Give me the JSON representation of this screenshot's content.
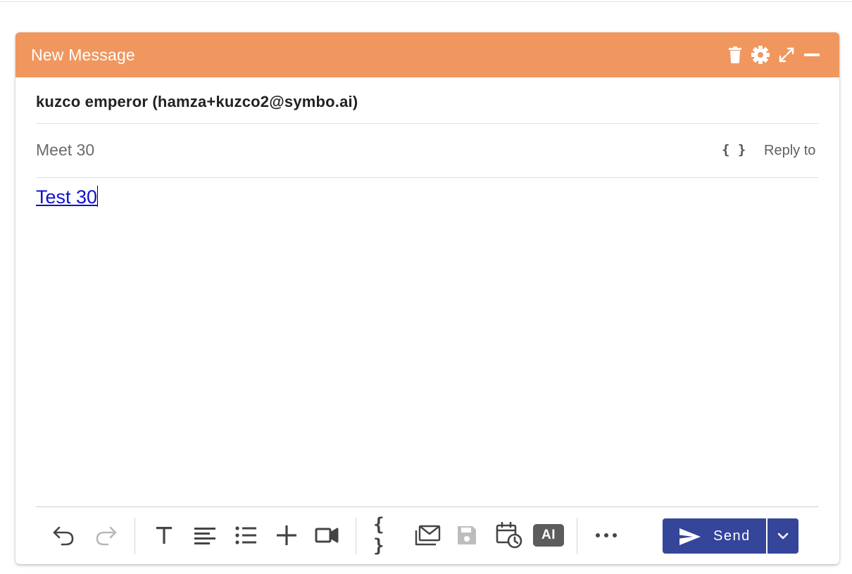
{
  "compose": {
    "title": "New Message",
    "header_color": "#f0975f",
    "recipient": "kuzco emperor (hamza+kuzco2@symbo.ai)",
    "subject": "Meet 30",
    "subject_variable_icon": "{ }",
    "reply_to_label": "Reply to",
    "body_text": "Test 30",
    "header_icons": [
      "trash-icon",
      "gear-icon",
      "expand-icon",
      "minimize-icon"
    ]
  },
  "toolbar": {
    "icons": [
      "undo-icon",
      "redo-icon",
      "text-format-icon",
      "align-left-icon",
      "bullet-list-icon",
      "plus-icon",
      "video-icon",
      "variables-icon",
      "mail-template-icon",
      "save-icon",
      "schedule-icon",
      "ai-icon",
      "more-icon"
    ],
    "variables_glyph": "{ }",
    "ai_label": "AI",
    "send_label": "Send",
    "send_color": "#34459a"
  }
}
